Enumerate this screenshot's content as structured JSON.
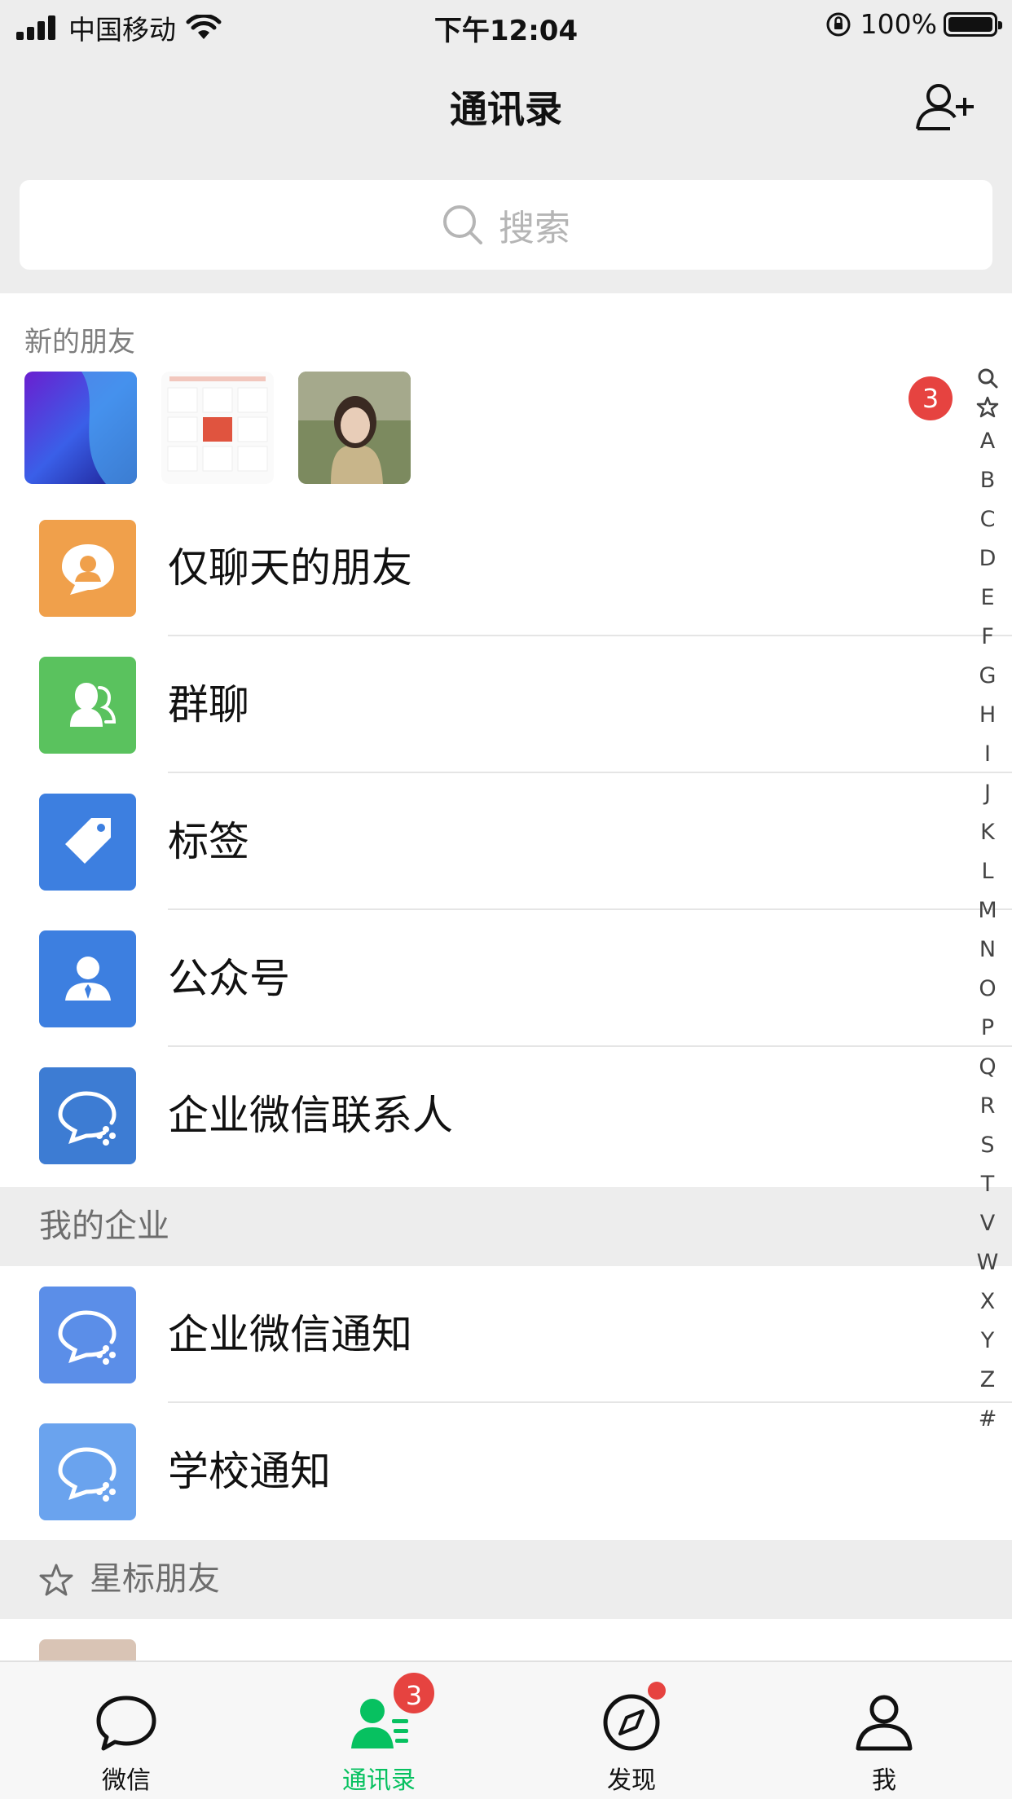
{
  "status_bar": {
    "carrier": "中国移动",
    "time": "下午12:04",
    "battery": "100%"
  },
  "nav": {
    "title": "通讯录",
    "add_icon": "add-contact-icon"
  },
  "search": {
    "placeholder": "搜索"
  },
  "new_friends": {
    "label": "新的朋友",
    "badge": "3"
  },
  "rows": [
    {
      "label": "仅聊天的朋友",
      "icon": "chat-only-friends-icon",
      "color": "#f0a04b"
    },
    {
      "label": "群聊",
      "icon": "group-chat-icon",
      "color": "#5ac25e"
    },
    {
      "label": "标签",
      "icon": "tag-icon",
      "color": "#3d7fe0"
    },
    {
      "label": "公众号",
      "icon": "official-account-icon",
      "color": "#3d7fe0"
    },
    {
      "label": "企业微信联系人",
      "icon": "wecom-contacts-icon",
      "color": "#3d7cd3"
    }
  ],
  "enterprise": {
    "header": "我的企业",
    "rows": [
      {
        "label": "企业微信通知",
        "icon": "wecom-notify-icon",
        "color": "#5b8ee8"
      },
      {
        "label": "学校通知",
        "icon": "school-notify-icon",
        "color": "#6aa3ee"
      }
    ]
  },
  "starred": {
    "header": "星标朋友"
  },
  "index": [
    "A",
    "B",
    "C",
    "D",
    "E",
    "F",
    "G",
    "H",
    "I",
    "J",
    "K",
    "L",
    "M",
    "N",
    "O",
    "P",
    "Q",
    "R",
    "S",
    "T",
    "V",
    "W",
    "X",
    "Y",
    "Z",
    "#"
  ],
  "tabs": [
    {
      "label": "微信",
      "icon": "chat-icon"
    },
    {
      "label": "通讯录",
      "icon": "contacts-icon",
      "badge": "3"
    },
    {
      "label": "发现",
      "icon": "discover-icon"
    },
    {
      "label": "我",
      "icon": "me-icon"
    }
  ],
  "colors": {
    "accent": "#07c160",
    "badge": "#e64340"
  }
}
